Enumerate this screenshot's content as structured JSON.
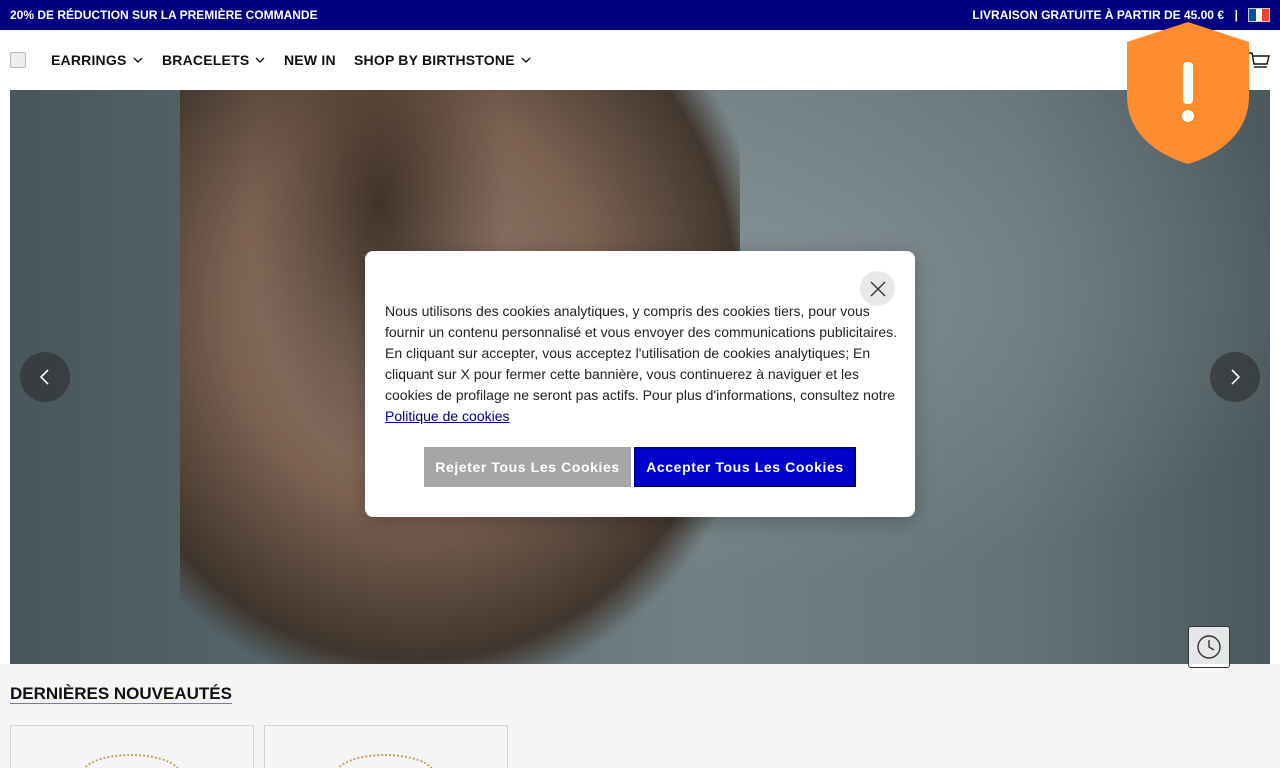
{
  "topbar": {
    "promo": "20% DE RÉDUCTION SUR LA PREMIÈRE COMMANDE",
    "shipping": "LIVRAISON GRATUITE À PARTIR DE 45.00 €",
    "separator": "|",
    "flag_colors": [
      "#0055a4",
      "#ffffff",
      "#ef4135"
    ]
  },
  "nav": {
    "items": [
      {
        "label": "EARRINGS",
        "dropdown": true
      },
      {
        "label": "BRACELETS",
        "dropdown": true
      },
      {
        "label": "NEW IN",
        "dropdown": false
      },
      {
        "label": "SHOP BY BIRTHSTONE",
        "dropdown": true
      }
    ],
    "icons": [
      "logo-image",
      "cart-icon",
      "chevron-down-icon"
    ]
  },
  "hero": {
    "icons": [
      "chevron-left-icon",
      "chevron-right-icon",
      "clock-icon"
    ]
  },
  "badge": {
    "icon": "shield-alert-icon",
    "color": "#ff8c2e",
    "glyph": "!"
  },
  "section": {
    "title": "DERNIÈRES NOUVEAUTÉS"
  },
  "cookie_modal": {
    "body": "Nous utilisons des cookies analytiques, y compris des cookies tiers, pour vous fournir un contenu personnalisé et vous envoyer des communications publicitaires. En cliquant sur accepter, vous acceptez l'utilisation de cookies analytiques; En cliquant sur X pour fermer cette bannière, vous continuerez à naviguer et les cookies de profilage ne seront pas actifs. Pour plus d'informations, consultez notre",
    "policy_link": "Politique de cookies",
    "reject_label": "Rejeter Tous Les Cookies",
    "accept_label": "Accepter Tous Les Cookies",
    "close_icon": "close-icon",
    "accent_color": "#0000cc"
  }
}
